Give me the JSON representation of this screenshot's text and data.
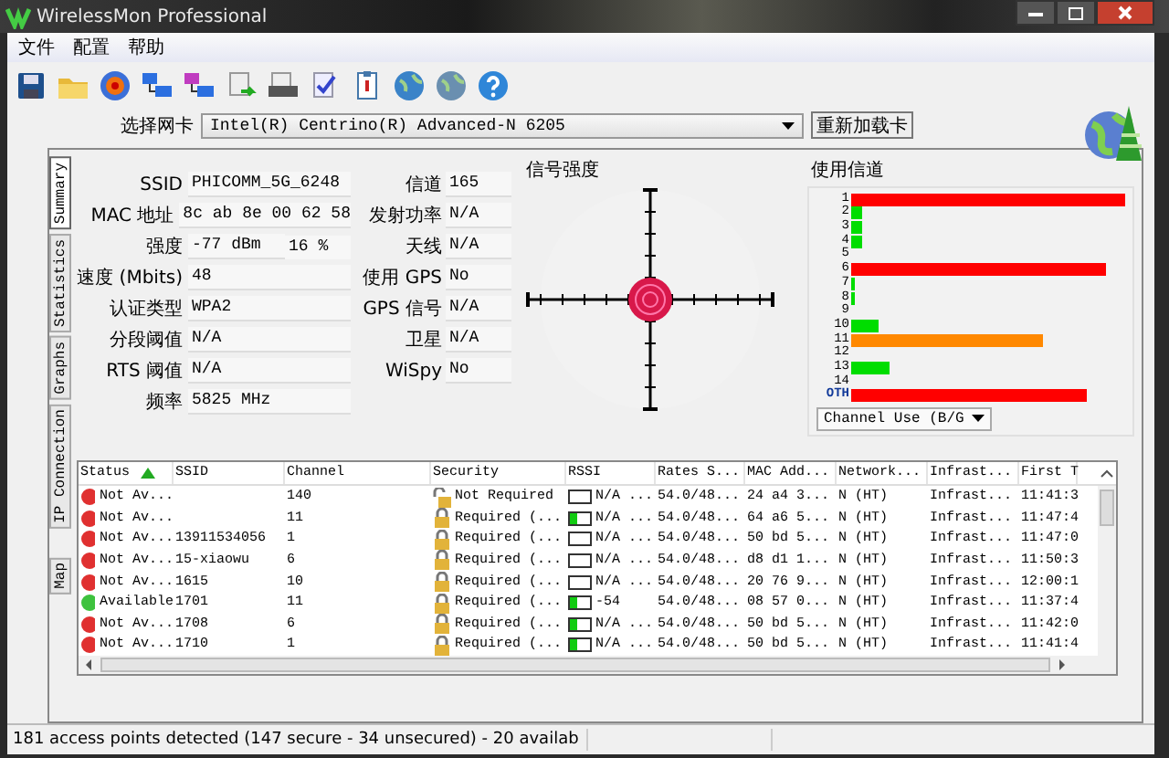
{
  "window": {
    "title": "WirelessMon Professional"
  },
  "menu": [
    "文件",
    "配置",
    "帮助"
  ],
  "adapter": {
    "label": "选择网卡",
    "value": "Intel(R) Centrino(R) Advanced-N 6205",
    "reload_button": "重新加载卡"
  },
  "side_tabs": [
    {
      "label": "Summary",
      "selected": true
    },
    {
      "label": "Statistics",
      "selected": false
    },
    {
      "label": "Graphs",
      "selected": false
    },
    {
      "label": "IP Connection",
      "selected": false
    },
    {
      "label": "Map",
      "selected": false
    }
  ],
  "summary": {
    "left": [
      {
        "label": "SSID",
        "value": "PHICOMM_5G_6248"
      },
      {
        "label": "MAC 地址",
        "value": "8c ab 8e 00 62 58"
      },
      {
        "label": "强度",
        "value": "-77 dBm",
        "extra": "16 %"
      },
      {
        "label": "速度 (Mbits)",
        "value": "48"
      },
      {
        "label": "认证类型",
        "value": "WPA2"
      },
      {
        "label": "分段阈值",
        "value": "N/A"
      },
      {
        "label": "RTS 阈值",
        "value": "N/A"
      },
      {
        "label": "频率",
        "value": "5825 MHz"
      }
    ],
    "right": [
      {
        "label": "信道",
        "value": "165"
      },
      {
        "label": "发射功率",
        "value": "N/A"
      },
      {
        "label": "天线",
        "value": "N/A"
      },
      {
        "label": "使用 GPS",
        "value": "No"
      },
      {
        "label": "GPS 信号",
        "value": "N/A"
      },
      {
        "label": "卫星",
        "value": "N/A"
      },
      {
        "label": "WiSpy",
        "value": "No"
      }
    ]
  },
  "signal": {
    "title": "信号强度"
  },
  "channels": {
    "title": "使用信道",
    "labels": [
      "1",
      "2",
      "3",
      "4",
      "5",
      "6",
      "7",
      "8",
      "9",
      "10",
      "11",
      "12",
      "13",
      "14",
      "OTH"
    ],
    "mode": "Channel Use (B/G"
  },
  "table": {
    "columns": [
      {
        "label": "Status",
        "sorted": true
      },
      {
        "label": "SSID",
        "sorted": false
      },
      {
        "label": "Channel",
        "sorted": false
      },
      {
        "label": "Security",
        "sorted": false
      },
      {
        "label": "RSSI",
        "sorted": false
      },
      {
        "label": "Rates S...",
        "sorted": false
      },
      {
        "label": "MAC Add...",
        "sorted": false
      },
      {
        "label": "Network...",
        "sorted": false
      },
      {
        "label": "Infrast...",
        "sorted": false
      },
      {
        "label": "First T",
        "sorted": false
      }
    ],
    "rows": [
      {
        "available": false,
        "status": "Not Av...",
        "ssid": "",
        "channel": "140",
        "locked": false,
        "security": "Not Required",
        "signal_bar": false,
        "rssi": "N/A ...",
        "rates": "54.0/48...",
        "mac": "24 a4 3...",
        "network": "N (HT)",
        "infra": "Infrast...",
        "first": "11:41:3"
      },
      {
        "available": false,
        "status": "Not Av...",
        "ssid": "",
        "channel": "11",
        "locked": true,
        "security": "Required (...",
        "signal_bar": true,
        "rssi": "N/A ...",
        "rates": "54.0/48...",
        "mac": "64 a6 5...",
        "network": "N (HT)",
        "infra": "Infrast...",
        "first": "11:47:4"
      },
      {
        "available": false,
        "status": "Not Av...",
        "ssid": "13911534056",
        "channel": "1",
        "locked": true,
        "security": "Required (...",
        "signal_bar": false,
        "rssi": "N/A ...",
        "rates": "54.0/48...",
        "mac": "50 bd 5...",
        "network": "N (HT)",
        "infra": "Infrast...",
        "first": "11:47:0"
      },
      {
        "available": false,
        "status": "Not Av...",
        "ssid": "15-xiaowu",
        "channel": "6",
        "locked": true,
        "security": "Required (...",
        "signal_bar": false,
        "rssi": "N/A ...",
        "rates": "54.0/48...",
        "mac": "d8 d1 1...",
        "network": "N (HT)",
        "infra": "Infrast...",
        "first": "11:50:3"
      },
      {
        "available": false,
        "status": "Not Av...",
        "ssid": "1615",
        "channel": "10",
        "locked": true,
        "security": "Required (...",
        "signal_bar": false,
        "rssi": "N/A ...",
        "rates": "54.0/48...",
        "mac": "20 76 9...",
        "network": "N (HT)",
        "infra": "Infrast...",
        "first": "12:00:1"
      },
      {
        "available": true,
        "status": "Available",
        "ssid": "1701",
        "channel": "11",
        "locked": true,
        "security": "Required (...",
        "signal_bar": true,
        "rssi": "-54",
        "rates": "54.0/48...",
        "mac": "08 57 0...",
        "network": "N (HT)",
        "infra": "Infrast...",
        "first": "11:37:4"
      },
      {
        "available": false,
        "status": "Not Av...",
        "ssid": "1708",
        "channel": "6",
        "locked": true,
        "security": "Required (...",
        "signal_bar": true,
        "rssi": "N/A ...",
        "rates": "54.0/48...",
        "mac": "50 bd 5...",
        "network": "N (HT)",
        "infra": "Infrast...",
        "first": "11:42:0"
      },
      {
        "available": false,
        "status": "Not Av...",
        "ssid": "1710",
        "channel": "1",
        "locked": true,
        "security": "Required (...",
        "signal_bar": true,
        "rssi": "N/A ...",
        "rates": "54.0/48...",
        "mac": "50 bd 5...",
        "network": "N (HT)",
        "infra": "Infrast...",
        "first": "11:41:4"
      }
    ]
  },
  "status_bar": "181 access points detected (147 secure - 34 unsecured) - 20 availab"
}
